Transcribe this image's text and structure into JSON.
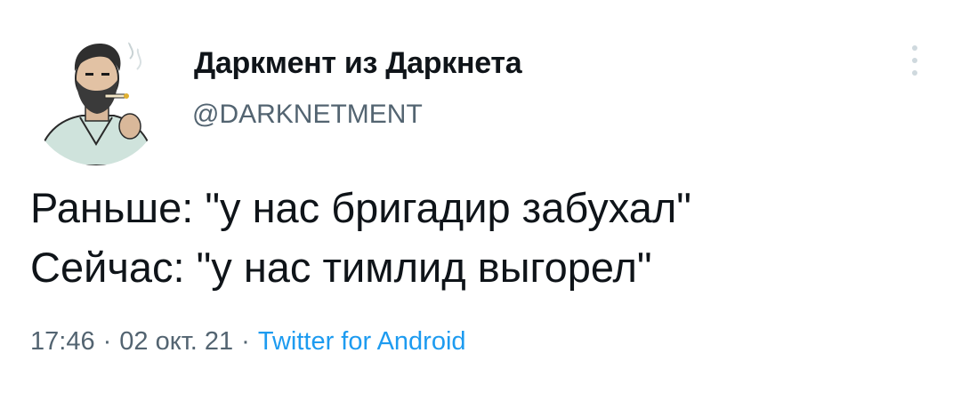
{
  "author": {
    "display_name": "Даркмент из Даркнета",
    "handle": "@DARKNETMENT",
    "avatar_icon": "bearded-man-avatar"
  },
  "tweet": {
    "lines": [
      "Раньше: \"у нас бригадир забухал\"",
      "Сейчас: \"у нас тимлид выгорел\""
    ]
  },
  "meta": {
    "time": "17:46",
    "separator": "·",
    "date": "02 окт. 21",
    "source": "Twitter for Android"
  },
  "menu": {
    "icon": "more-vertical-icon"
  },
  "colors": {
    "text": "#0f1419",
    "secondary": "#536471",
    "link": "#1d9bf0",
    "menu_dots": "#cfd9de",
    "background": "#ffffff"
  }
}
